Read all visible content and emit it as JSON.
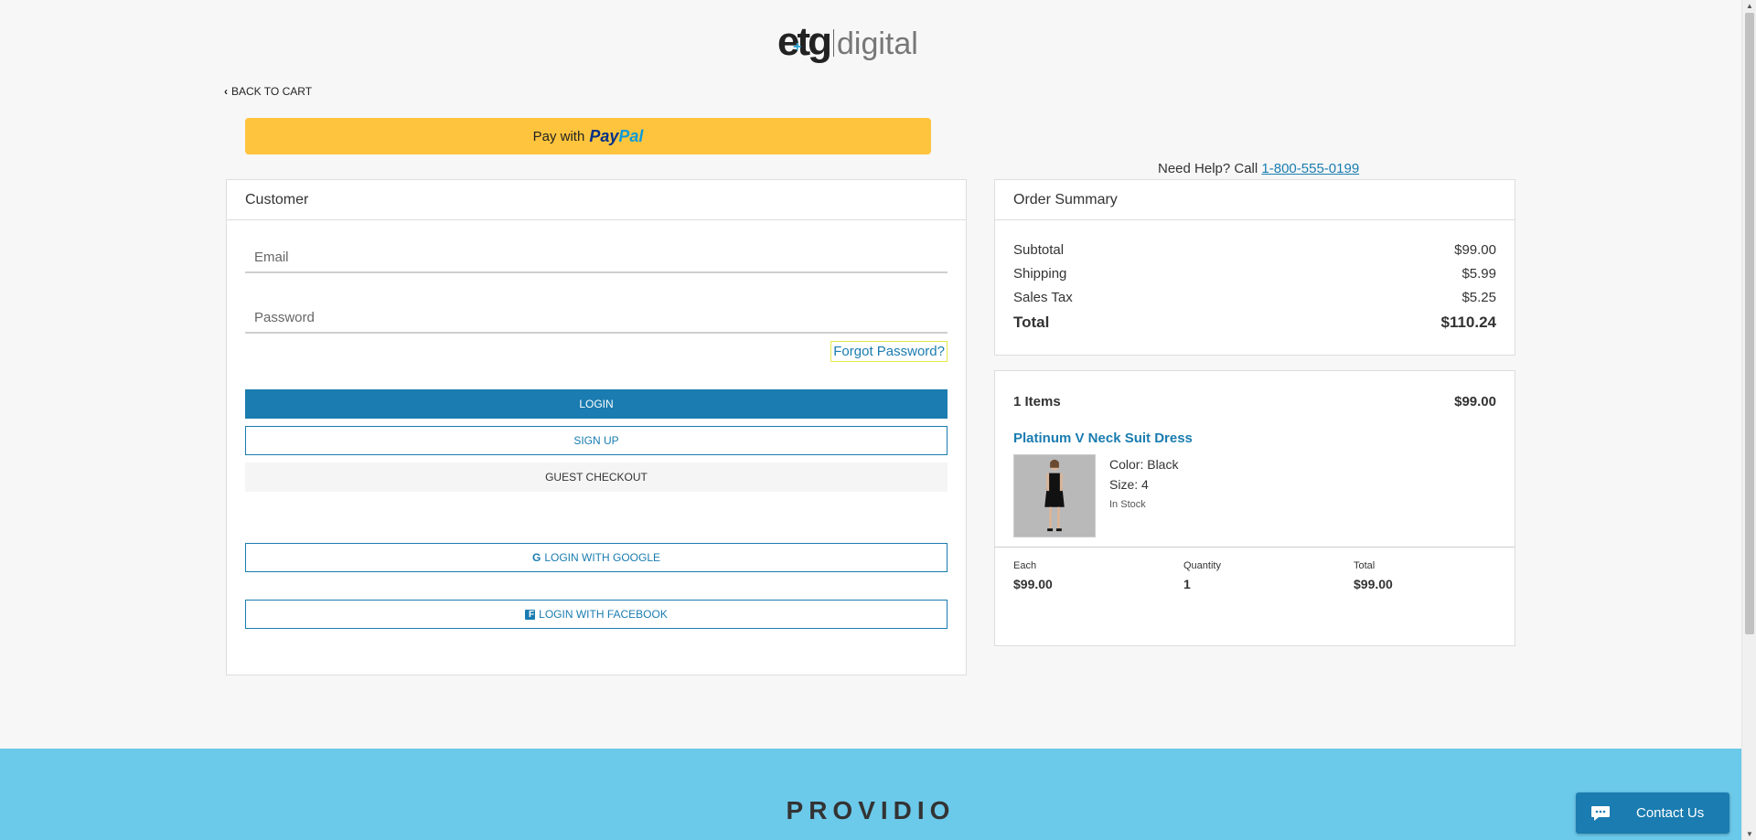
{
  "logo": {
    "brand": "etg",
    "word": "digital"
  },
  "nav": {
    "back_label": "BACK TO CART"
  },
  "paypal": {
    "prefix": "Pay with",
    "pay": "Pay",
    "pal": "Pal"
  },
  "help": {
    "prefix": "Need Help? Call",
    "phone": "1-800-555-0199"
  },
  "customer": {
    "title": "Customer",
    "email_placeholder": "Email",
    "password_placeholder": "Password",
    "forgot_label": "Forgot Password?",
    "login_label": "LOGIN",
    "signup_label": "SIGN UP",
    "guest_label": "GUEST CHECKOUT",
    "google_label": "LOGIN WITH GOOGLE",
    "facebook_label": "LOGIN WITH FACEBOOK"
  },
  "summary": {
    "title": "Order Summary",
    "rows": [
      {
        "label": "Subtotal",
        "value": "$99.00"
      },
      {
        "label": "Shipping",
        "value": "$5.99"
      },
      {
        "label": "Sales Tax",
        "value": "$5.25"
      }
    ],
    "total_label": "Total",
    "total_value": "$110.24"
  },
  "items": {
    "count_label": "1 Items",
    "count_value": "$99.00",
    "product": {
      "name": "Platinum V Neck Suit Dress",
      "color": "Color: Black",
      "size": "Size: 4",
      "stock": "In Stock",
      "each_label": "Each",
      "each_value": "$99.00",
      "qty_label": "Quantity",
      "qty_value": "1",
      "total_label": "Total",
      "total_value": "$99.00"
    }
  },
  "footer": {
    "brand": "PROVIDIO"
  },
  "chat": {
    "label": "Contact Us"
  },
  "colors": {
    "accent": "#1a7cb0",
    "paypal": "#ffc43d",
    "footer": "#6bc9ea"
  }
}
